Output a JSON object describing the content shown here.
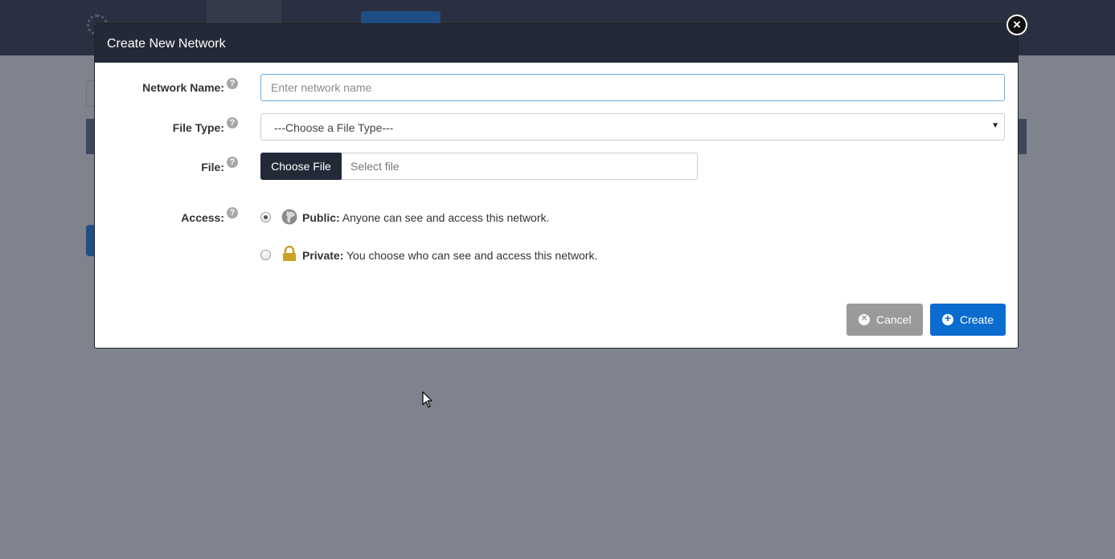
{
  "background": {
    "logo_text": "",
    "user_text": ""
  },
  "modal": {
    "title": "Create New Network",
    "close_icon": "close-circle-icon",
    "help_icon_glyph": "?",
    "fields": {
      "network_name": {
        "label": "Network Name:",
        "placeholder": "Enter network name",
        "value": ""
      },
      "file_type": {
        "label": "File Type:",
        "selected": "---Choose a File Type---"
      },
      "file": {
        "label": "File:",
        "button_label": "Choose File",
        "placeholder": "Select file"
      },
      "access": {
        "label": "Access:",
        "options": [
          {
            "name": "Public:",
            "description": "Anyone can see and access this network.",
            "icon": "globe-icon",
            "selected": true
          },
          {
            "name": "Private:",
            "description": "You choose who can see and access this network.",
            "icon": "lock-icon",
            "selected": false
          }
        ]
      }
    },
    "buttons": {
      "cancel": {
        "label": "Cancel",
        "icon": "cancel-circle-icon",
        "color": "#9a9a9a"
      },
      "create": {
        "label": "Create",
        "icon": "plus-circle-icon",
        "color": "#0b6ccf"
      }
    }
  },
  "colors": {
    "header_dark": "#232937",
    "overlay": "#7f838d",
    "primary": "#0b6ccf"
  }
}
